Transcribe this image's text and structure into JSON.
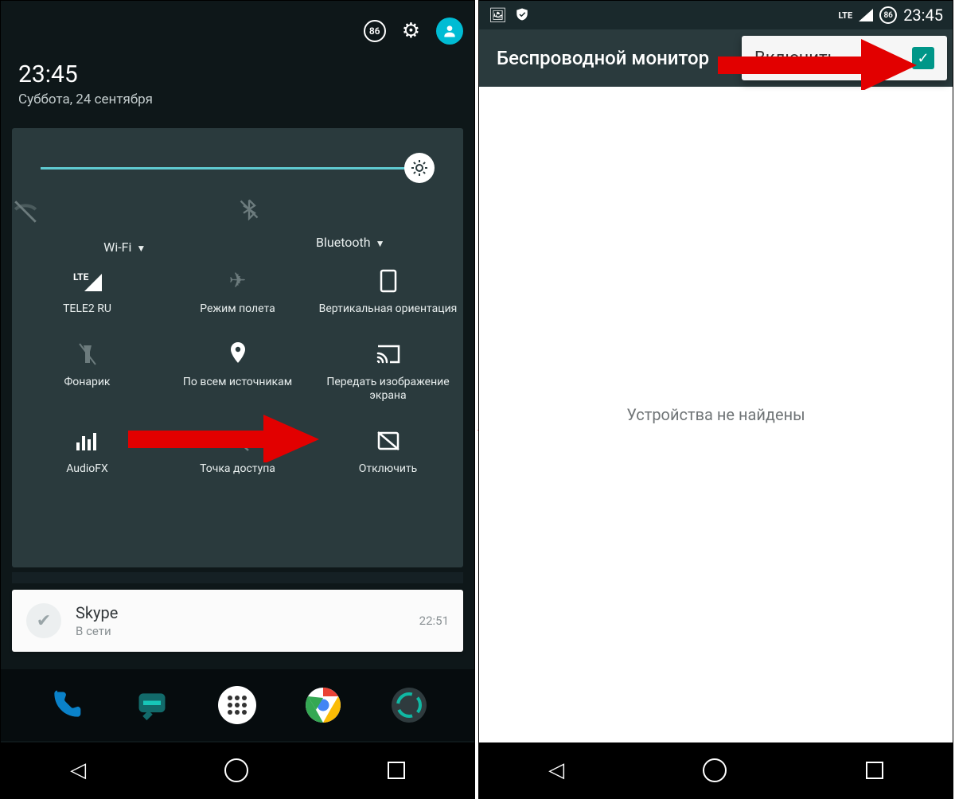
{
  "left": {
    "header": {
      "badge": "86"
    },
    "clock": {
      "time": "23:45",
      "date": "Суббота, 24 сентября"
    },
    "wifi_label": "Wi-Fi",
    "bt_label": "Bluetooth",
    "tiles": [
      {
        "label": "TELE2 RU"
      },
      {
        "label": "Режим полета"
      },
      {
        "label": "Вертикальная ориентация"
      },
      {
        "label": "Фонарик"
      },
      {
        "label": "По всем источникам"
      },
      {
        "label": "Передать изображение экрана"
      },
      {
        "label": "AudioFX"
      },
      {
        "label": "Точка доступа"
      },
      {
        "label": "Отключить"
      }
    ],
    "notification": {
      "app": "Skype",
      "subtitle": "В сети",
      "time": "22:51"
    }
  },
  "right": {
    "status": {
      "network": "LTE",
      "battery": "86",
      "time": "23:45"
    },
    "appbar_title": "Беспроводной монитор",
    "enable_label": "Включить",
    "empty_message": "Устройства не найдены"
  }
}
